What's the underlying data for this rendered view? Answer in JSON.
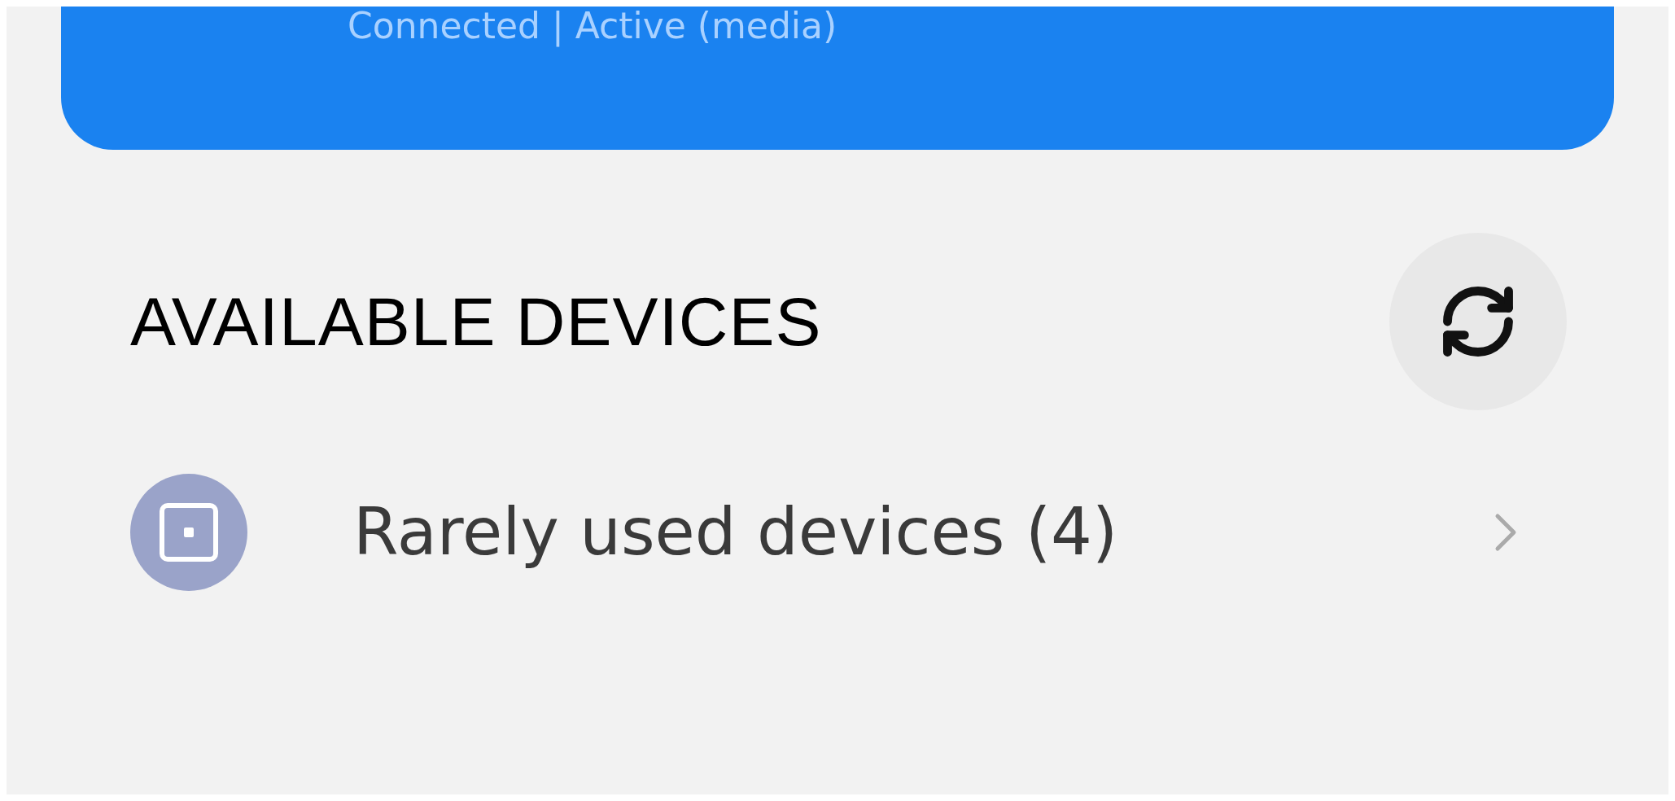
{
  "connected_device": {
    "status": "Connected | Active (media)"
  },
  "section": {
    "title": "AVAILABLE DEVICES"
  },
  "rows": [
    {
      "label": "Rarely used devices (4)"
    }
  ]
}
